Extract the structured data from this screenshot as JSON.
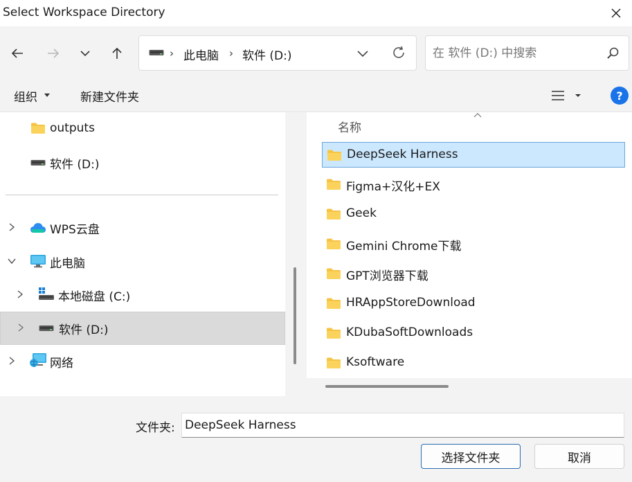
{
  "window": {
    "title": "Select Workspace Directory"
  },
  "address": {
    "parts": [
      "此电脑",
      "软件 (D:)"
    ]
  },
  "search": {
    "placeholder": "在 软件 (D:) 中搜索"
  },
  "toolbar": {
    "organize": "组织",
    "new_folder": "新建文件夹"
  },
  "nav": {
    "items": [
      {
        "label": "outputs"
      },
      {
        "label": "软件 (D:)"
      },
      {
        "label": "WPS云盘"
      },
      {
        "label": "此电脑"
      },
      {
        "label": "本地磁盘 (C:)"
      },
      {
        "label": "软件 (D:)"
      },
      {
        "label": "网络"
      }
    ]
  },
  "files": {
    "column_name": "名称",
    "items": [
      "DeepSeek Harness",
      "Figma+汉化+EX",
      "Geek",
      "Gemini Chrome下载",
      "GPT浏览器下载",
      "HRAppStoreDownload",
      "KDubaSoftDownloads",
      "Ksoftware"
    ]
  },
  "footer": {
    "folder_label": "文件夹:",
    "folder_value": "DeepSeek Harness",
    "select_button": "选择文件夹",
    "cancel_button": "取消"
  },
  "colors": {
    "accent": "#1a73e8",
    "selection": "#cce8ff",
    "folder": "#f6c445"
  }
}
